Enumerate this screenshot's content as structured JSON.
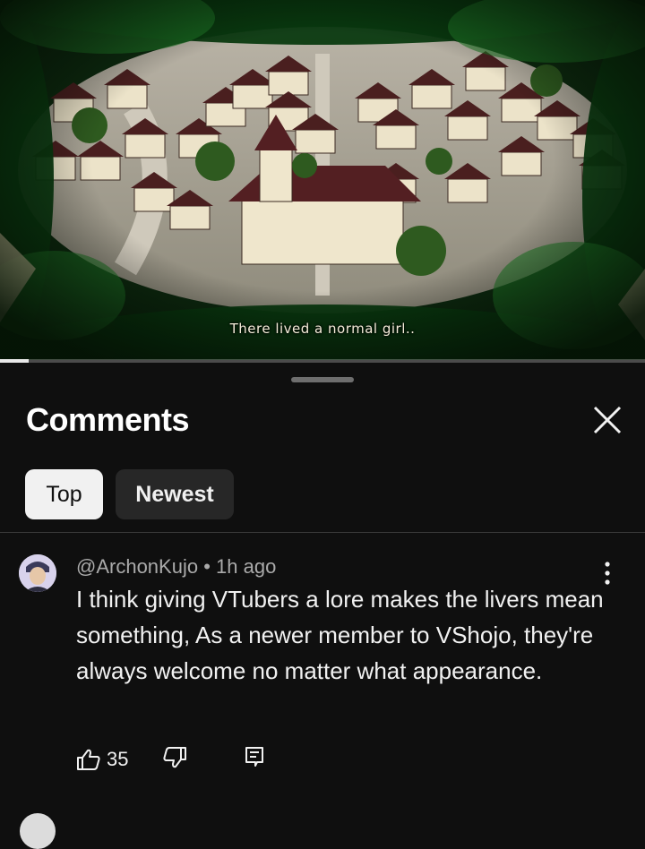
{
  "video": {
    "subtitle": "There lived a normal girl..",
    "progress_fraction": 0.045
  },
  "comments_panel": {
    "title": "Comments",
    "close_icon": "close-icon",
    "filters": [
      {
        "label": "Top",
        "selected": true
      },
      {
        "label": "Newest",
        "selected": false
      }
    ],
    "comments": [
      {
        "author": "@ArchonKujo",
        "separator": "•",
        "time": "1h ago",
        "text": "I think giving VTubers a lore makes the livers mean something, As a newer member to VShojo, they're always welcome no matter what appearance.",
        "likes": "35",
        "icons": {
          "like": "thumbs-up-icon",
          "dislike": "thumbs-down-icon",
          "reply": "reply-icon",
          "more": "more-vert-icon"
        }
      }
    ],
    "next_comment_meta_partial": "@..."
  },
  "colors": {
    "background": "#0f0f0f",
    "chip_selected": "#f1f1f1",
    "chip_unselected": "#272727",
    "meta_text": "#aaaaaa"
  }
}
